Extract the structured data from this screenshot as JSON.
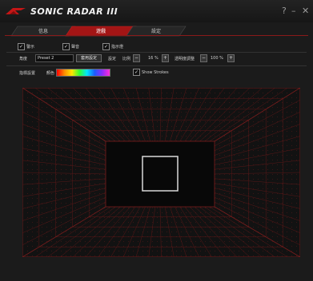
{
  "window": {
    "title": "SONIC RADAR III",
    "help_label": "?",
    "minimize_label": "–",
    "close_label": "✕"
  },
  "tabs": [
    {
      "label": "信息"
    },
    {
      "label": "遊戲"
    },
    {
      "label": "設定"
    }
  ],
  "options_row": {
    "items": [
      {
        "label": "警示",
        "checked": true
      },
      {
        "label": "聲音",
        "checked": true
      },
      {
        "label": "指示燈",
        "checked": true
      }
    ]
  },
  "profile_row": {
    "label": "角度",
    "profile_value": "Preset 2",
    "apply_button": "套用設定",
    "setting_label": "設定",
    "scale_label": "比例",
    "scale_value": "16 %",
    "opacity_label": "透明度調整",
    "opacity_value": "100 %",
    "minus_label": "−",
    "plus_label": "+"
  },
  "appearance_row": {
    "label": "指標設置",
    "color_label": "顏色",
    "show_strokes_label": "Show Strokes",
    "show_strokes_checked": true
  },
  "colors": {
    "accent": "#b31b1b",
    "grid": "#7a1d1d",
    "focus_box": "#d9d9d9"
  }
}
